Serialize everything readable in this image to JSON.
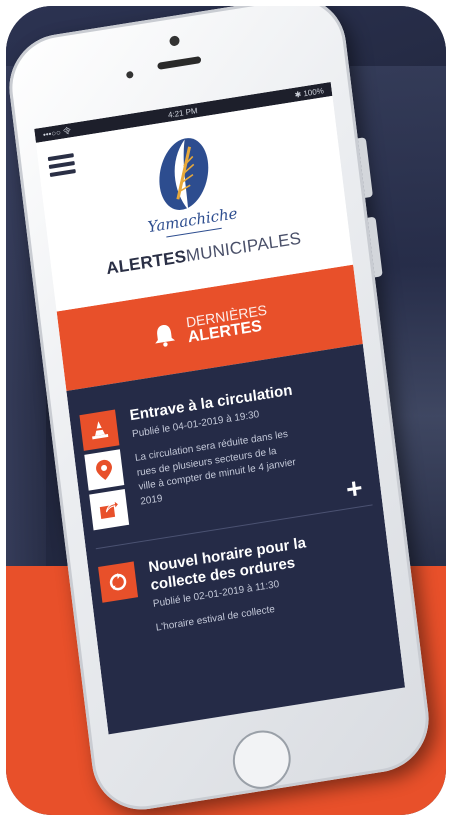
{
  "status_bar": {
    "carrier": "•••○○ 令",
    "time": "4:21 PM",
    "battery": "✱ 100%"
  },
  "brand": {
    "script": "Yamachiche",
    "name_bold": "ALERTES",
    "name_light": "MUNICIPALES"
  },
  "band": {
    "line1": "DERNIÈRES",
    "line2": "ALERTES"
  },
  "alerts": [
    {
      "title": "Entrave à la circulation",
      "date": "Publié le 04-01-2019 à 19:30",
      "body": "La circulation sera réduite dans les rues de plusieurs secteurs de la ville à compter de minuit le 4 janvier 2019",
      "expand": "+"
    },
    {
      "title": "Nouvel horaire pour la collecte des ordures",
      "date": "Publié le 02-01-2019 à 11:30",
      "body": "L'horaire estival de collecte"
    }
  ],
  "colors": {
    "accent": "#e8502a",
    "navy": "#252b47",
    "logo_blue": "#2d4d8f"
  },
  "icons": [
    "menu-icon",
    "bell-icon",
    "traffic-cone-icon",
    "map-pin-icon",
    "share-icon",
    "recycle-icon",
    "plus-icon"
  ]
}
